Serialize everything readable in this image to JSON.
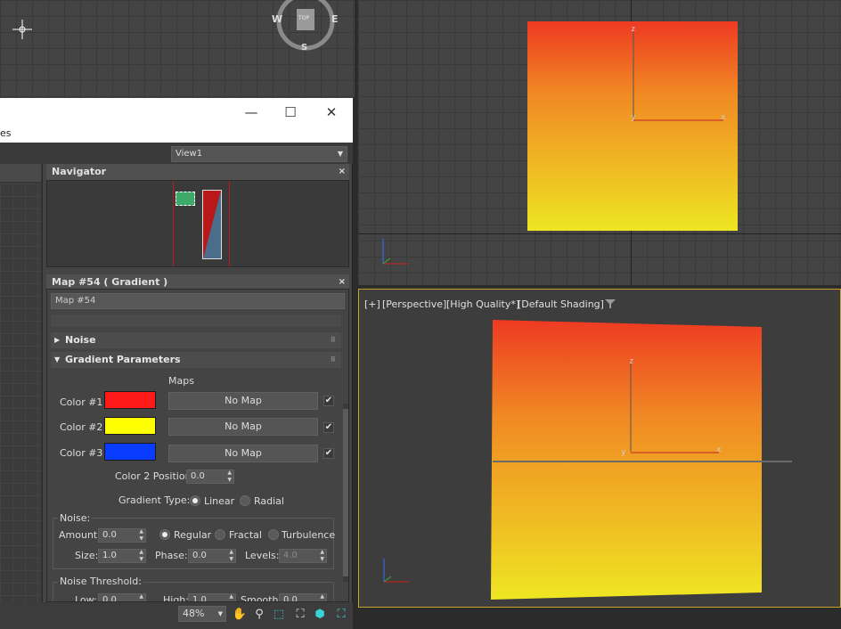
{
  "viewport_top": {
    "compass": {
      "w": "W",
      "e": "E",
      "s": "S",
      "top": "TOP"
    },
    "gizmo": {
      "z": "z",
      "x": "x",
      "y": "y"
    }
  },
  "viewport_persp": {
    "labels": [
      "[+]",
      "[Perspective]",
      "[High Quality*]",
      "[Default Shading]"
    ],
    "gizmo": {
      "z": "z",
      "x": "x",
      "y": "y"
    }
  },
  "window": {
    "menu_fragment": "es",
    "view_select": "View1",
    "navigator": {
      "title": "Navigator",
      "close": "×"
    },
    "map": {
      "title": "Map #54  ( Gradient )",
      "close": "×",
      "name_value": "Map #54",
      "rollouts": {
        "noise": "Noise",
        "gradient": "Gradient Parameters"
      },
      "maps_header": "Maps",
      "colors": [
        {
          "label": "Color #1",
          "hex": "#ff1a1a",
          "map": "No Map",
          "checked": "✔"
        },
        {
          "label": "Color #2",
          "hex": "#ffff00",
          "map": "No Map",
          "checked": "✔"
        },
        {
          "label": "Color #3",
          "hex": "#0a3cff",
          "map": "No Map",
          "checked": "✔"
        }
      ],
      "color2_position": {
        "label": "Color 2 Position:",
        "value": "0.0"
      },
      "gradient_type": {
        "label": "Gradient Type:",
        "options": [
          "Linear",
          "Radial"
        ],
        "selected": "Linear"
      },
      "noise": {
        "group_label": "Noise:",
        "amount_label": "Amount:",
        "amount": "0.0",
        "types": [
          "Regular",
          "Fractal",
          "Turbulence"
        ],
        "selected": "Regular",
        "size_label": "Size:",
        "size": "1.0",
        "phase_label": "Phase:",
        "phase": "0.0",
        "levels_label": "Levels:",
        "levels": "4.0"
      },
      "threshold": {
        "group_label": "Noise Threshold:",
        "low_label": "Low:",
        "low": "0.0",
        "high_label": "High:",
        "high": "1.0",
        "smooth_label": "Smooth:",
        "smooth": "0.0"
      }
    },
    "zoom": "48%"
  }
}
